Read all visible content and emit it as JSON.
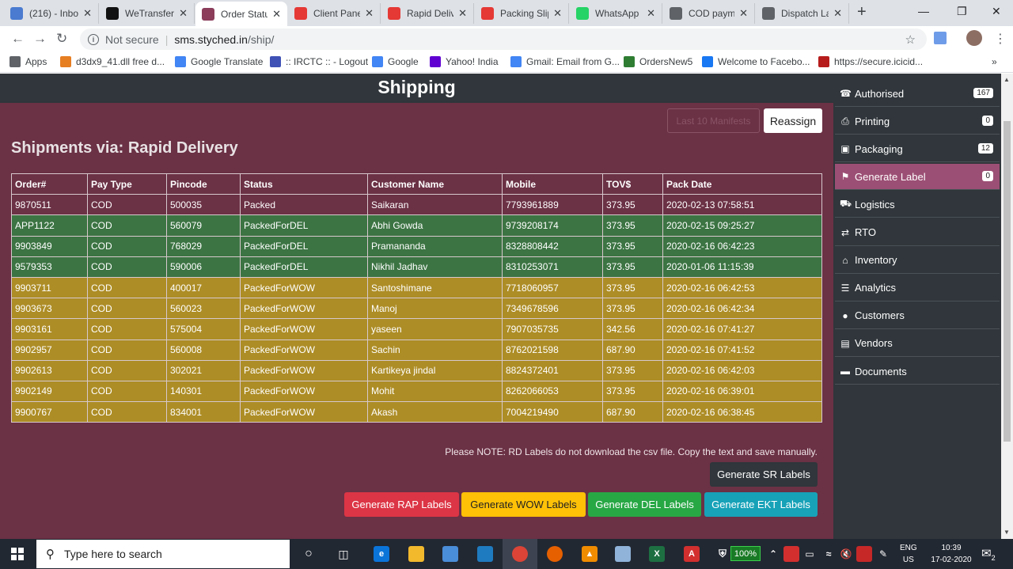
{
  "browser": {
    "tabs": [
      {
        "label": "(216) - Inbo",
        "icon": "mail-icon",
        "color": "#4a7bd0"
      },
      {
        "label": "WeTransfer",
        "icon": "wetransfer-icon",
        "color": "#111111"
      },
      {
        "label": "Order Statu",
        "icon": "site-icon",
        "color": "#8b3d5a",
        "active": true
      },
      {
        "label": "Client Panel",
        "icon": "client-panel-icon",
        "color": "#e53935"
      },
      {
        "label": "Rapid Delive",
        "icon": "pdf-icon",
        "color": "#e53935"
      },
      {
        "label": "Packing Slip",
        "icon": "pdf-icon",
        "color": "#e53935"
      },
      {
        "label": "WhatsApp",
        "icon": "whatsapp-icon",
        "color": "#25d366"
      },
      {
        "label": "COD payme",
        "icon": "globe-icon",
        "color": "#5f6368"
      },
      {
        "label": "Dispatch La",
        "icon": "globe-icon",
        "color": "#5f6368"
      }
    ],
    "address": {
      "security": "Not secure",
      "host": "sms.styched.in",
      "path": "/ship/"
    },
    "bookmarks": [
      {
        "label": "Apps",
        "color": "#5f6368"
      },
      {
        "label": "d3dx9_41.dll free d...",
        "color": "#e67e22"
      },
      {
        "label": "Google Translate",
        "color": "#4285f4"
      },
      {
        "label": ":: IRCTC :: - Logout",
        "color": "#3f51b5"
      },
      {
        "label": "Google",
        "color": "#4285f4"
      },
      {
        "label": "Yahoo! India",
        "color": "#6001d2"
      },
      {
        "label": "Gmail: Email from G...",
        "color": "#4285f4"
      },
      {
        "label": "OrdersNew5",
        "color": "#2e7d32"
      },
      {
        "label": "Welcome to Facebo...",
        "color": "#1877f2"
      },
      {
        "label": "https://secure.icicid...",
        "color": "#b71c1c"
      }
    ]
  },
  "page": {
    "header_title": "Shipping",
    "ghost_button": "Last 10 Manifests",
    "reassign_button": "Reassign",
    "shipments_title": "Shipments via: Rapid Delivery",
    "table": {
      "headers": [
        "Order#",
        "Pay Type",
        "Pincode",
        "Status",
        "Customer Name",
        "Mobile",
        "TOV$",
        "Pack Date"
      ],
      "rows": [
        [
          "9870511",
          "COD",
          "500035",
          "Packed",
          "Saikaran",
          "7793961889",
          "373.95",
          "2020-02-13 07:58:51"
        ],
        [
          "APP1122",
          "COD",
          "560079",
          "PackedForDEL",
          "Abhi Gowda",
          "9739208174",
          "373.95",
          "2020-02-15 09:25:27"
        ],
        [
          "9903849",
          "COD",
          "768029",
          "PackedForDEL",
          "Pramananda",
          "8328808442",
          "373.95",
          "2020-02-16 06:42:23"
        ],
        [
          "9579353",
          "COD",
          "590006",
          "PackedForDEL",
          "Nikhil Jadhav",
          "8310253071",
          "373.95",
          "2020-01-06 11:15:39"
        ],
        [
          "9903711",
          "COD",
          "400017",
          "PackedForWOW",
          "Santoshimane",
          "7718060957",
          "373.95",
          "2020-02-16 06:42:53"
        ],
        [
          "9903673",
          "COD",
          "560023",
          "PackedForWOW",
          "Manoj",
          "7349678596",
          "373.95",
          "2020-02-16 06:42:34"
        ],
        [
          "9903161",
          "COD",
          "575004",
          "PackedForWOW",
          "yaseen",
          "7907035735",
          "342.56",
          "2020-02-16 07:41:27"
        ],
        [
          "9902957",
          "COD",
          "560008",
          "PackedForWOW",
          "Sachin",
          "8762021598",
          "687.90",
          "2020-02-16 07:41:52"
        ],
        [
          "9902613",
          "COD",
          "302021",
          "PackedForWOW",
          "Kartikeya jindal",
          "8824372401",
          "373.95",
          "2020-02-16 06:42:03"
        ],
        [
          "9902149",
          "COD",
          "140301",
          "PackedForWOW",
          "Mohit",
          "8262066053",
          "373.95",
          "2020-02-16 06:39:01"
        ],
        [
          "9900767",
          "COD",
          "834001",
          "PackedForWOW",
          "Akash",
          "7004219490",
          "687.90",
          "2020-02-16 06:38:45"
        ]
      ]
    },
    "status_colors": {
      "Packed": "#6b3145",
      "PackedForDEL": "#3c7443",
      "PackedForWOW": "#ad8d26"
    },
    "note": "Please NOTE: RD Labels do not download the csv file. Copy the text and save manually.",
    "buttons": {
      "sr": "Generate SR Labels",
      "rap": "Generate RAP Labels",
      "wow": "Generate WOW Labels",
      "del": "Generate DEL Labels",
      "ekt": "Generate EKT Labels"
    }
  },
  "sidebar": {
    "items": [
      {
        "label": "Authorised",
        "icon": "phone-icon",
        "badge": "167"
      },
      {
        "label": "Printing",
        "icon": "printer-icon",
        "badge": "0"
      },
      {
        "label": "Packaging",
        "icon": "cubes-icon",
        "badge": "12"
      },
      {
        "label": "Generate Label",
        "icon": "tag-icon",
        "badge": "0",
        "active": true
      },
      {
        "label": "Logistics",
        "icon": "truck-icon"
      },
      {
        "label": "RTO",
        "icon": "exchange-icon"
      },
      {
        "label": "Inventory",
        "icon": "home-icon"
      },
      {
        "label": "Analytics",
        "icon": "barcode-icon"
      },
      {
        "label": "Customers",
        "icon": "user-icon"
      },
      {
        "label": "Vendors",
        "icon": "file-icon"
      },
      {
        "label": "Documents",
        "icon": "card-icon"
      }
    ]
  },
  "taskbar": {
    "search_placeholder": "Type here to search",
    "battery": "100%",
    "language": "ENG",
    "region": "US",
    "time": "10:39",
    "date": "17-02-2020",
    "notifications": "2"
  }
}
